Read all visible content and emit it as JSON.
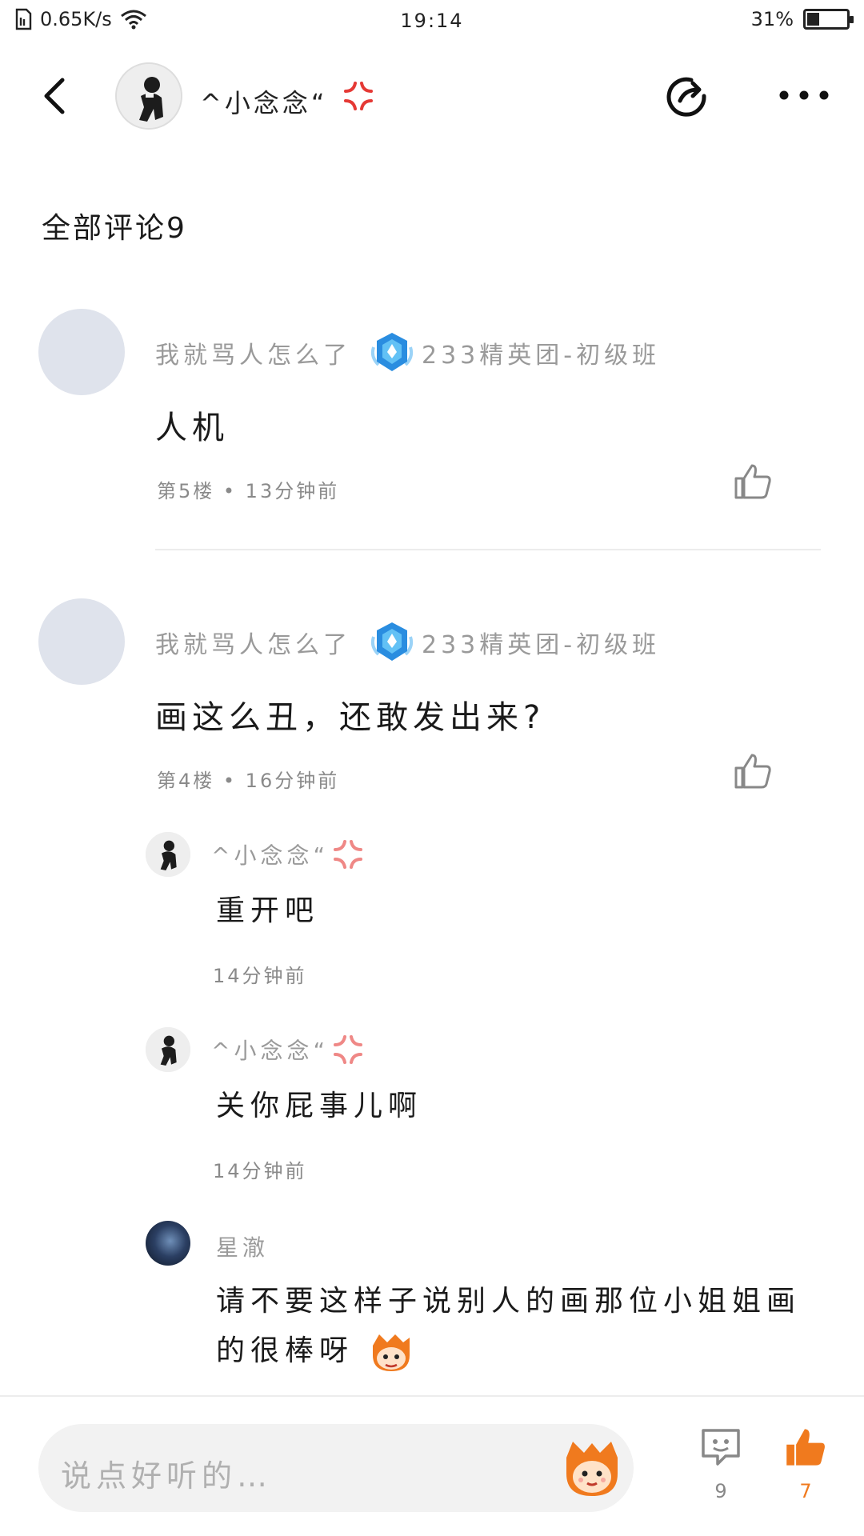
{
  "status_bar": {
    "network_speed": "0.65K/s",
    "time": "19:14",
    "battery_percent": "31%",
    "battery_level": 0.31
  },
  "header": {
    "username": "^小念念“"
  },
  "section_title": "全部评论9",
  "comments": [
    {
      "username": "我就骂人怎么了",
      "badge": "233精英团-初级班",
      "text": "人机",
      "floor_time": "第5楼 • 13分钟前"
    },
    {
      "username": "我就骂人怎么了",
      "badge": "233精英团-初级班",
      "text": "画这么丑，还敢发出来?",
      "floor_time": "第4楼 • 16分钟前",
      "replies": [
        {
          "username": "^小念念“",
          "text": "重开吧",
          "time": "14分钟前"
        },
        {
          "username": "^小念念“",
          "text": "关你屁事儿啊",
          "time": "14分钟前"
        },
        {
          "username": "星澈",
          "text": "请不要这样子说别人的画那位小姐姐画的很棒呀"
        }
      ]
    }
  ],
  "bottom_bar": {
    "input_placeholder": "说点好听的…",
    "comment_count": "9",
    "like_count": "7"
  },
  "colors": {
    "accent_orange": "#f07a1e",
    "meta_gray": "#9a9a9a",
    "badge_blue": "#2a8de0"
  },
  "icons": [
    "back-icon",
    "share-icon",
    "more-icon",
    "thumbs-up-icon",
    "comment-icon",
    "emoji-icon",
    "anger-emoji-icon",
    "level-badge-icon"
  ]
}
